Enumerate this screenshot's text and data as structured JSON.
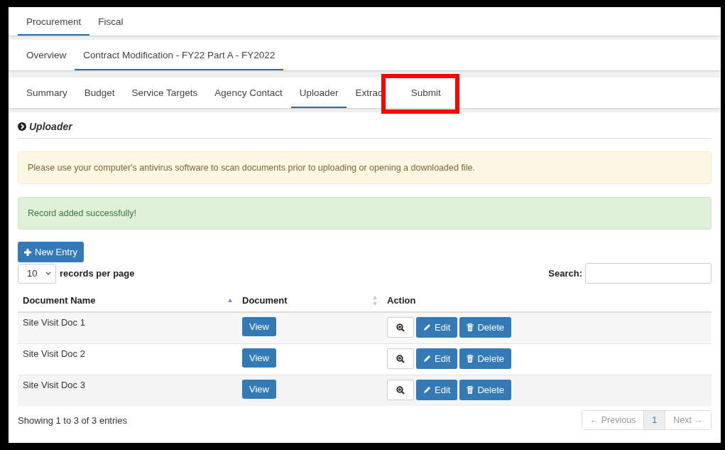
{
  "top_tabs": [
    {
      "label": "Procurement",
      "selected": true
    },
    {
      "label": "Fiscal",
      "selected": false
    }
  ],
  "record_tabs": [
    {
      "label": "Overview",
      "selected": false
    },
    {
      "label": "Contract Modification - FY22 Part A - FY2022",
      "selected": true
    }
  ],
  "section_tabs": [
    {
      "label": "Summary",
      "selected": false,
      "highlighted": false
    },
    {
      "label": "Budget",
      "selected": false,
      "highlighted": false
    },
    {
      "label": "Service Targets",
      "selected": false,
      "highlighted": false
    },
    {
      "label": "Agency Contact",
      "selected": false,
      "highlighted": false
    },
    {
      "label": "Uploader",
      "selected": true,
      "highlighted": false
    },
    {
      "label": "Extrac",
      "selected": false,
      "highlighted": false
    },
    {
      "label": "Submit",
      "selected": false,
      "highlighted": true
    }
  ],
  "panel": {
    "title": "Uploader",
    "alerts": [
      {
        "kind": "warning",
        "text": "Please use your computer's antivirus software to scan documents prior to uploading or opening a downloaded file."
      },
      {
        "kind": "success",
        "text": "Record added successfully!"
      }
    ],
    "new_button": "New Entry",
    "page_size": {
      "value": "10",
      "label": "records per page"
    },
    "search": {
      "label": "Search:"
    },
    "table": {
      "columns": [
        {
          "label": "Document Name",
          "sortable": true,
          "sorted_ascending": true
        },
        {
          "label": "Document",
          "sortable": true,
          "sorted_ascending": false
        },
        {
          "label": "Action",
          "sortable": false
        }
      ],
      "rows": [
        {
          "name": "Site Visit Doc 1",
          "view": "View",
          "edit": "Edit",
          "delete": "Delete"
        },
        {
          "name": "Site Visit Doc 2",
          "view": "View",
          "edit": "Edit",
          "delete": "Delete"
        },
        {
          "name": "Site Visit Doc 3",
          "view": "View",
          "edit": "Edit",
          "delete": "Delete"
        }
      ]
    },
    "info": "Showing 1 to 3 of 3 entries",
    "pagination": [
      {
        "label": "← Previous",
        "selected": false,
        "disabled": true
      },
      {
        "label": "1",
        "selected": true,
        "disabled": false
      },
      {
        "label": "Next →",
        "selected": false,
        "disabled": true
      }
    ]
  }
}
